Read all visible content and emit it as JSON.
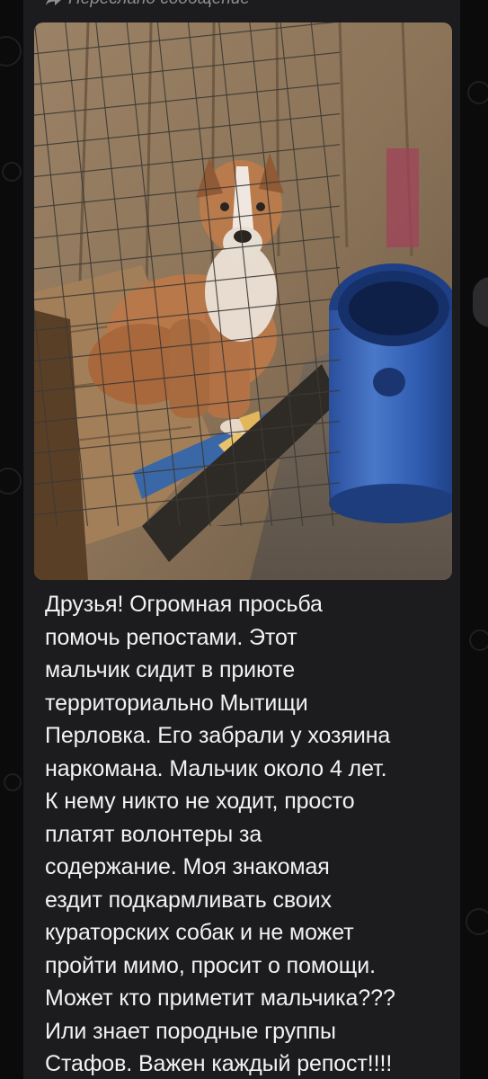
{
  "message": {
    "forward_label": "Переслано сообщение",
    "forward_icon": "forward-arrow-icon",
    "photo_icon": "dog-in-cage-photo",
    "text": "Друзья! Огромная просьба\nпомочь репостами.  Этот\nмальчик сидит в приюте\nтерриториально Мытищи\nПерловка. Его забрали у хозяина\nнаркомана. Мальчик около 4 лет.\nК нему никто не ходит, просто\nплатят волонтеры за\nсодержание. Моя знакомая\nездит подкармливать своих\nкураторских собак и не может\nпройти мимо, просит о помощи.\nМожет кто приметит мальчика???\nИли знает породные группы\nСтафов. Важен каждый репост!!!!"
  },
  "colors": {
    "background": "#0b0b0c",
    "bubble": "#1c1c1e",
    "text": "#f2f2f2",
    "meta": "#8e8e93"
  }
}
